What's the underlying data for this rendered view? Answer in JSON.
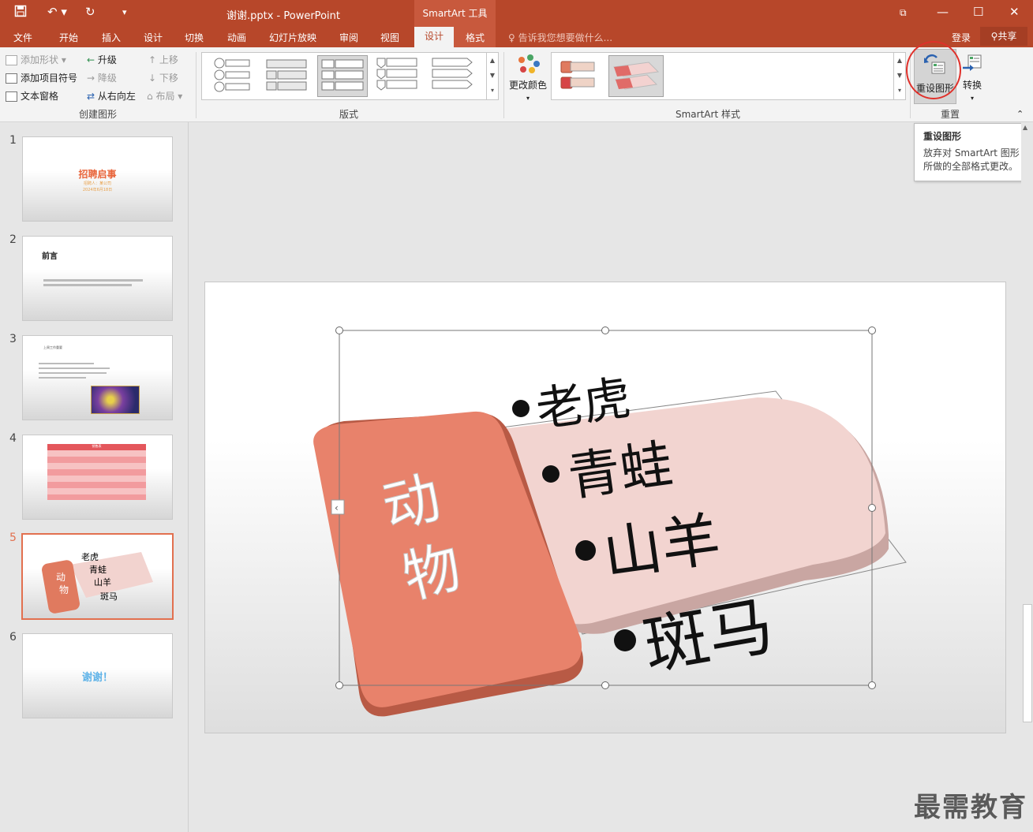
{
  "titlebar": {
    "doc_title": "谢谢.pptx - PowerPoint",
    "context_header": "SmartArt 工具",
    "save_icon": "save-icon",
    "undo_icon": "undo-icon",
    "redo_icon": "redo-icon"
  },
  "tabs": [
    "文件",
    "开始",
    "插入",
    "设计",
    "切换",
    "动画",
    "幻灯片放映",
    "审阅",
    "视图",
    "设计",
    "格式"
  ],
  "tell_me": "告诉我您想要做什么...",
  "account": {
    "login": "登录",
    "share": "共享"
  },
  "ribbon": {
    "create_graphic": {
      "name": "创建图形",
      "add_shape": "添加形状",
      "add_bullet": "添加项目符号",
      "text_pane": "文本窗格",
      "promote": "升级",
      "demote": "降级",
      "right_to_left": "从右向左",
      "move_up": "上移",
      "move_down": "下移",
      "layout": "布局"
    },
    "layouts": {
      "name": "版式"
    },
    "styles": {
      "name": "SmartArt 样式",
      "change_colors": "更改颜色"
    },
    "reset": {
      "name": "重置",
      "reset_graphic": "重设图形",
      "convert": "转换"
    }
  },
  "tooltip": {
    "title": "重设图形",
    "body": "放弃对 SmartArt 图形所做的全部格式更改。"
  },
  "thumbnails": [
    {
      "num": "1",
      "title": "招聘启事",
      "sub": "招聘人：某公司",
      "date": "2024年6月18日"
    },
    {
      "num": "2",
      "title": "前言"
    },
    {
      "num": "3",
      "title": "上周工作重要"
    },
    {
      "num": "4",
      "title": "销售表"
    },
    {
      "num": "5"
    },
    {
      "num": "6",
      "title": "谢谢！"
    }
  ],
  "slide": {
    "category": "动物",
    "items": [
      "老虎",
      "青蛙",
      "山羊",
      "斑马"
    ]
  },
  "watermark": "最需教育"
}
